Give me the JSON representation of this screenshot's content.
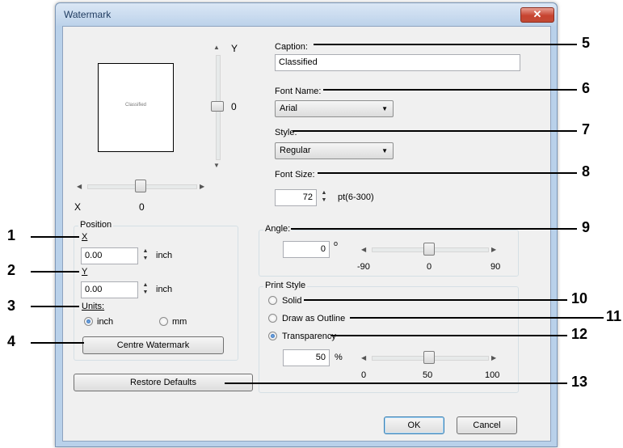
{
  "dialog": {
    "title": "Watermark",
    "close_glyph": "✕"
  },
  "preview": {
    "page_text": "Classified",
    "y_axis_label": "Y",
    "y_value": "0",
    "x_axis_label": "X",
    "x_value": "0"
  },
  "position": {
    "group_label": "Position",
    "x_label": "X",
    "x_value": "0.00",
    "x_unit": "inch",
    "y_label": "Y",
    "y_value": "0.00",
    "y_unit": "inch",
    "units_label": "Units:",
    "units_inch": "inch",
    "units_mm": "mm",
    "units_selected": "inch",
    "centre_button": "Centre Watermark"
  },
  "restore_defaults": "Restore Defaults",
  "caption": {
    "label": "Caption:",
    "value": "Classified"
  },
  "font_name": {
    "label": "Font Name:",
    "value": "Arial"
  },
  "style": {
    "label": "Style:",
    "value": "Regular"
  },
  "font_size": {
    "label": "Font Size:",
    "value": "72",
    "range_text": "pt(6-300)"
  },
  "angle": {
    "label": "Angle:",
    "value": "0",
    "degree_symbol": "o",
    "slider_min": "-90",
    "slider_mid": "0",
    "slider_max": "90",
    "slider_value": 0
  },
  "print_style": {
    "group_label": "Print Style",
    "solid": "Solid",
    "outline": "Draw as Outline",
    "transparency": "Transparency",
    "selected": "Transparency",
    "transparency_value": "50",
    "percent": "%",
    "slider_min": "0",
    "slider_mid": "50",
    "slider_max": "100",
    "slider_value": 50
  },
  "buttons": {
    "ok": "OK",
    "cancel": "Cancel"
  },
  "callouts": [
    "1",
    "2",
    "3",
    "4",
    "5",
    "6",
    "7",
    "8",
    "9",
    "10",
    "11",
    "12",
    "13"
  ]
}
